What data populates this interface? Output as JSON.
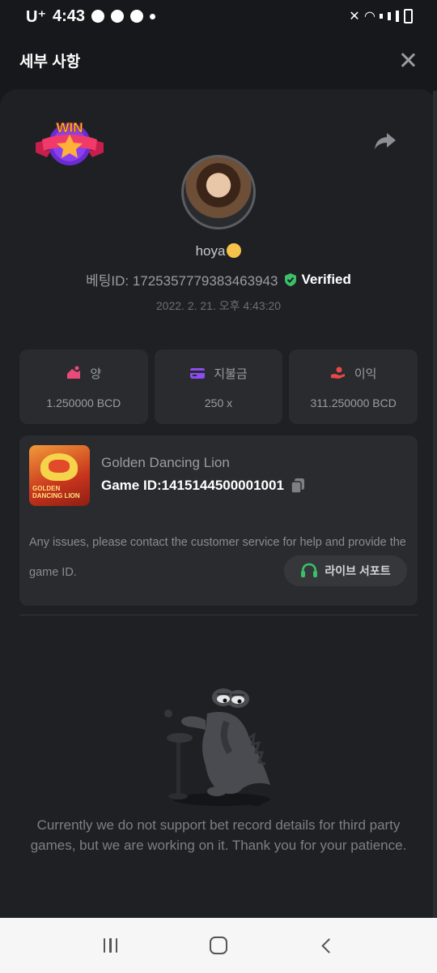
{
  "status_bar": {
    "carrier": "U⁺",
    "time": "4:43"
  },
  "header": {
    "title": "세부 사항"
  },
  "win_badge": {
    "text": "WIN"
  },
  "profile": {
    "username": "hoya",
    "bet_id": "베팅ID: 1725357779383463943",
    "verified_label": "Verified",
    "datetime": "2022. 2. 21. 오후 4:43:20"
  },
  "stats": [
    {
      "label": "양",
      "value": "1.250000 BCD",
      "icon": "amount-icon",
      "color": "#e94a7a"
    },
    {
      "label": "지불금",
      "value": "250 x",
      "icon": "wallet-icon",
      "color": "#8a4cf0"
    },
    {
      "label": "이익",
      "value": "311.250000 BCD",
      "icon": "profit-hand-icon",
      "color": "#e8484a"
    }
  ],
  "game": {
    "name": "Golden Dancing Lion",
    "game_id": "Game ID:1415144500001001",
    "thumb_text": "GOLDEN DANCING LION"
  },
  "notice": "Any issues, please contact the customer service for help and provide the game ID.",
  "live_support_label": "라이브 서포트",
  "empty_message": "Currently we do not support bet record details for third party games, but we are working on it. Thank you for your patience.",
  "colors": {
    "background": "#17181b",
    "panel": "#1f2023",
    "card": "#2a2b2e",
    "verified_green": "#3bc06a",
    "headset_green": "#3bc06a"
  }
}
